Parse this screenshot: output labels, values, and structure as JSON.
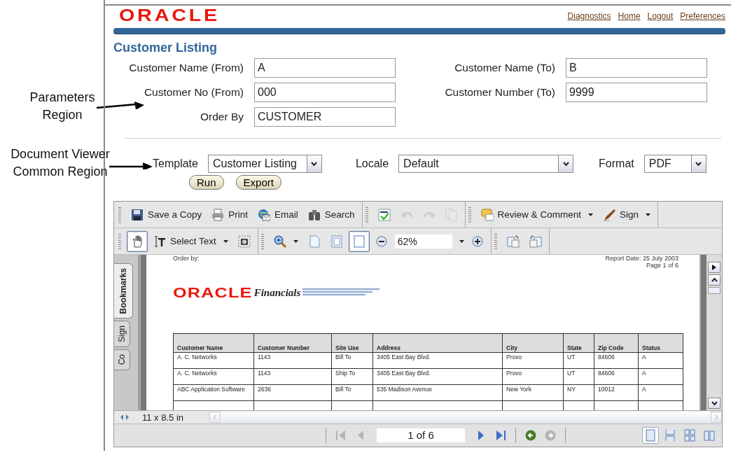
{
  "annotations": [
    {
      "text": "Parameters Region"
    },
    {
      "text": "Document Viewer Common Region"
    }
  ],
  "header": {
    "logo": "ORACLE",
    "links": [
      "Diagnostics",
      "Home",
      "Logout",
      "Preferences"
    ]
  },
  "page_title": "Customer Listing",
  "parameters": [
    {
      "label": "Customer Name (From)",
      "value": "A"
    },
    {
      "label": "Customer Name (To)",
      "value": "B"
    },
    {
      "label": "Customer No (From)",
      "value": "000"
    },
    {
      "label": "Customer Number (To)",
      "value": "9999"
    },
    {
      "label": "Order By",
      "value": "CUSTOMER"
    }
  ],
  "viewer_common": {
    "selects": [
      {
        "label": "Template",
        "value": "Customer Listing"
      },
      {
        "label": "Locale",
        "value": "Default"
      },
      {
        "label": "Format",
        "value": "PDF"
      }
    ],
    "buttons": [
      "Run",
      "Export"
    ]
  },
  "viewer": {
    "toolbar_1": [
      {
        "items": [
          {
            "kind": "button",
            "label": "Save a Copy",
            "disabled": false
          },
          {
            "kind": "button",
            "label": "Print",
            "disabled": false
          },
          {
            "kind": "button",
            "label": "Email",
            "disabled": false
          },
          {
            "kind": "button",
            "label": "Search",
            "disabled": false
          }
        ]
      },
      {
        "items": [
          {
            "kind": "button",
            "disabled": false
          },
          {
            "kind": "button",
            "disabled": true
          },
          {
            "kind": "button",
            "disabled": true
          },
          {
            "kind": "button",
            "disabled": true
          }
        ]
      },
      {
        "items": [
          {
            "kind": "button",
            "label": "Review & Comment",
            "dropdown": true,
            "disabled": false
          },
          {
            "kind": "button",
            "label": "Sign",
            "dropdown": true,
            "disabled": false
          }
        ]
      }
    ],
    "toolbar_2": [
      {
        "items": [
          {
            "kind": "button",
            "selected": true
          },
          {
            "kind": "button",
            "label": "Select Text",
            "dropdown": true,
            "selected": false
          },
          {
            "kind": "button",
            "selected": false
          }
        ]
      },
      {
        "items": [
          {
            "kind": "button",
            "dropdown": true,
            "selected": false
          },
          {
            "kind": "button",
            "selected": false
          },
          {
            "kind": "button",
            "selected": false
          },
          {
            "kind": "button",
            "selected": true
          },
          {
            "kind": "button",
            "selected": false
          },
          {
            "kind": "field",
            "value": "62%",
            "dropdown": true
          },
          {
            "kind": "button",
            "selected": false
          }
        ]
      },
      {
        "items": [
          {
            "kind": "button",
            "selected": false
          },
          {
            "kind": "button",
            "selected": false
          }
        ]
      }
    ],
    "side_tabs": [
      {
        "label": "Bookmarks",
        "selected": true
      },
      {
        "label": "Sign",
        "selected": false
      },
      {
        "label": "Co",
        "selected": false
      }
    ],
    "document": {
      "order_by": "Order by:",
      "report_date": "Report Date: 25 July 2003",
      "page": "Page 1 of 6",
      "logo": "ORACLE",
      "logo_suffix": "Financials",
      "table": {
        "columns": [
          "Customer Name",
          "Customer Number",
          "Site Use",
          "Address",
          "City",
          "State",
          "Zip Code",
          "Status"
        ],
        "rows": [
          [
            "A. C. Networks",
            "1143",
            "Bill To",
            "3405 East Bay Blvd.",
            "Provo",
            "UT",
            "84606",
            "A"
          ],
          [
            "A. C. Networks",
            "1143",
            "Ship To",
            "3405 East Bay Blvd.",
            "Provo",
            "UT",
            "84606",
            "A"
          ],
          [
            "ABC Application Software",
            "2636",
            "Bill To",
            "535 Madison Avenue",
            "New York",
            "NY",
            "10012",
            "A"
          ]
        ]
      }
    },
    "page_size": "11 x 8.5 in",
    "navigation": {
      "page_field": "1 of 6",
      "buttons": [
        {
          "disabled": true
        },
        {
          "disabled": true
        },
        {
          "disabled": false
        },
        {
          "disabled": false
        },
        {
          "disabled": false
        },
        {
          "disabled": true
        }
      ],
      "views": [
        {
          "selected": true
        },
        {
          "selected": false
        },
        {
          "selected": false
        },
        {
          "selected": false
        }
      ]
    }
  }
}
